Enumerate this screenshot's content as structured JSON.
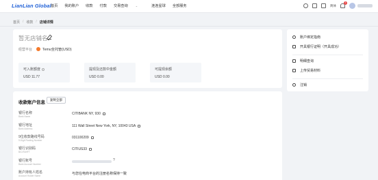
{
  "app": {
    "logo": "LianLian Global"
  },
  "nav": {
    "items": [
      "首页",
      "我的账户",
      "收款",
      "付款",
      "交易查询",
      "连连星球",
      "全部服务"
    ],
    "dropdown_caret": "⌄"
  },
  "topbar": {
    "badge": "1",
    "lang": "简体"
  },
  "breadcrumb": {
    "items": [
      "首页",
      "收款",
      "店铺详情"
    ],
    "separator": "/"
  },
  "store": {
    "name": "暂无店铺名",
    "platform_label": "经营平台",
    "platform_value": "Temu全托管(USD)",
    "stats": [
      {
        "label": "可入账额度",
        "value": "USD 11.77"
      },
      {
        "label": "提现及还款中金额",
        "value": "USD 0.00"
      },
      {
        "label": "可提现余额",
        "value": "USD 0.00"
      }
    ]
  },
  "account": {
    "title": "收款账户信息",
    "copy_all": "复制全部",
    "rows": [
      {
        "label": "银行名称",
        "label_en": "Bank Name",
        "value": "CITIBANK NY, 930"
      },
      {
        "label": "银行地址",
        "label_en": "Bank Address",
        "value": "111 Wall Street New York, NY, 10043 USA"
      },
      {
        "label": "9位收款路线号码",
        "label_en": "9-Digit Routing Number",
        "value": "031100209"
      },
      {
        "label": "银行识别码",
        "label_en": "BIC/SWIFT",
        "value": "CITIUS33"
      },
      {
        "label": "银行账号",
        "label_en": "Bank Account Number",
        "value": "",
        "masked_mark": "?"
      },
      {
        "label": "账户持有人姓名",
        "label_en": "Account Holder Name",
        "value": "与您在电商平台的注册名称保持一致"
      }
    ]
  },
  "side": {
    "items": [
      {
        "label": "账户绑定指南",
        "icon": "compass-icon"
      },
      {
        "label": "开具银行证明（开具成功）",
        "icon": "file-icon"
      },
      {
        "label": "明细查询",
        "icon": "list-icon"
      },
      {
        "label": "上传贸易材料",
        "icon": "upload-icon"
      },
      {
        "label": "注销",
        "icon": "power-icon"
      }
    ]
  }
}
